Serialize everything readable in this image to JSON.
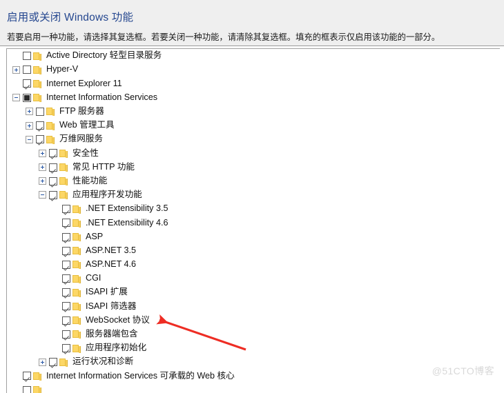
{
  "header": {
    "title": "启用或关闭 Windows 功能",
    "description": "若要启用一种功能，请选择其复选框。若要关闭一种功能，请清除其复选框。填充的框表示仅启用该功能的一部分。",
    "title_color": "#25478f",
    "band_color": "#efefef"
  },
  "tree": {
    "rows": [
      {
        "label": "Active Directory 轻型目录服务",
        "depth": 0,
        "expander": "none",
        "check": "unchecked"
      },
      {
        "label": "Hyper-V",
        "depth": 0,
        "expander": "plus",
        "check": "unchecked"
      },
      {
        "label": "Internet Explorer 11",
        "depth": 0,
        "expander": "none",
        "check": "checked"
      },
      {
        "label": "Internet Information Services",
        "depth": 0,
        "expander": "minus",
        "check": "filled"
      },
      {
        "label": "FTP 服务器",
        "depth": 1,
        "expander": "plus",
        "check": "unchecked"
      },
      {
        "label": "Web 管理工具",
        "depth": 1,
        "expander": "plus",
        "check": "checked"
      },
      {
        "label": "万维网服务",
        "depth": 1,
        "expander": "minus",
        "check": "checked"
      },
      {
        "label": "安全性",
        "depth": 2,
        "expander": "plus",
        "check": "checked"
      },
      {
        "label": "常见 HTTP 功能",
        "depth": 2,
        "expander": "plus",
        "check": "checked"
      },
      {
        "label": "性能功能",
        "depth": 2,
        "expander": "plus",
        "check": "checked"
      },
      {
        "label": "应用程序开发功能",
        "depth": 2,
        "expander": "minus",
        "check": "checked"
      },
      {
        "label": ".NET Extensibility 3.5",
        "depth": 3,
        "expander": "none",
        "check": "checked"
      },
      {
        "label": ".NET Extensibility 4.6",
        "depth": 3,
        "expander": "none",
        "check": "checked"
      },
      {
        "label": "ASP",
        "depth": 3,
        "expander": "none",
        "check": "checked"
      },
      {
        "label": "ASP.NET 3.5",
        "depth": 3,
        "expander": "none",
        "check": "checked"
      },
      {
        "label": "ASP.NET 4.6",
        "depth": 3,
        "expander": "none",
        "check": "checked"
      },
      {
        "label": "CGI",
        "depth": 3,
        "expander": "none",
        "check": "checked"
      },
      {
        "label": "ISAPI 扩展",
        "depth": 3,
        "expander": "none",
        "check": "checked"
      },
      {
        "label": "ISAPI 筛选器",
        "depth": 3,
        "expander": "none",
        "check": "checked"
      },
      {
        "label": "WebSocket 协议",
        "depth": 3,
        "expander": "none",
        "check": "checked"
      },
      {
        "label": "服务器端包含",
        "depth": 3,
        "expander": "none",
        "check": "checked"
      },
      {
        "label": "应用程序初始化",
        "depth": 3,
        "expander": "none",
        "check": "checked"
      },
      {
        "label": "运行状况和诊断",
        "depth": 2,
        "expander": "plus",
        "check": "checked"
      },
      {
        "label": "Internet Information Services 可承载的 Web 核心",
        "depth": 0,
        "expander": "none",
        "check": "checked"
      },
      {
        "label": "",
        "depth": 0,
        "expander": "none",
        "check": "unchecked"
      }
    ]
  },
  "annotation": {
    "arrow_color": "#ee2d24",
    "points_to": "WebSocket 协议"
  },
  "watermark": {
    "text": "@51CTO博客"
  }
}
